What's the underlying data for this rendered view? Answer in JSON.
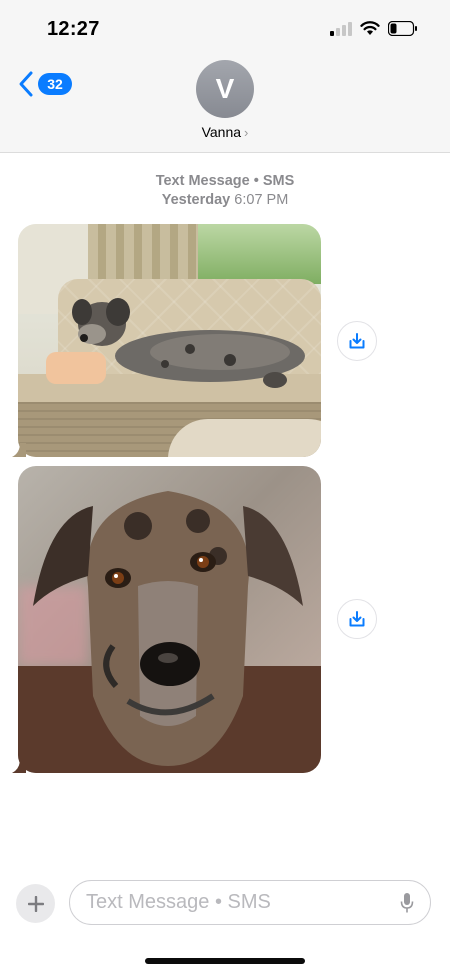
{
  "status_bar": {
    "time": "12:27"
  },
  "header": {
    "back_badge": "32",
    "avatar_initial": "V",
    "contact_name": "Vanna"
  },
  "conversation": {
    "service_label": "Text Message • SMS",
    "timestamp_day": "Yesterday",
    "timestamp_time": "6:07 PM"
  },
  "input_bar": {
    "placeholder": "Text Message • SMS"
  },
  "colors": {
    "accent": "#0a7cff",
    "header_bg": "#f6f6f6",
    "meta_text": "#8a8a8e"
  },
  "icons": {
    "back": "chevron-left-icon",
    "save": "download-icon",
    "plus": "plus-icon",
    "mic": "microphone-icon"
  }
}
